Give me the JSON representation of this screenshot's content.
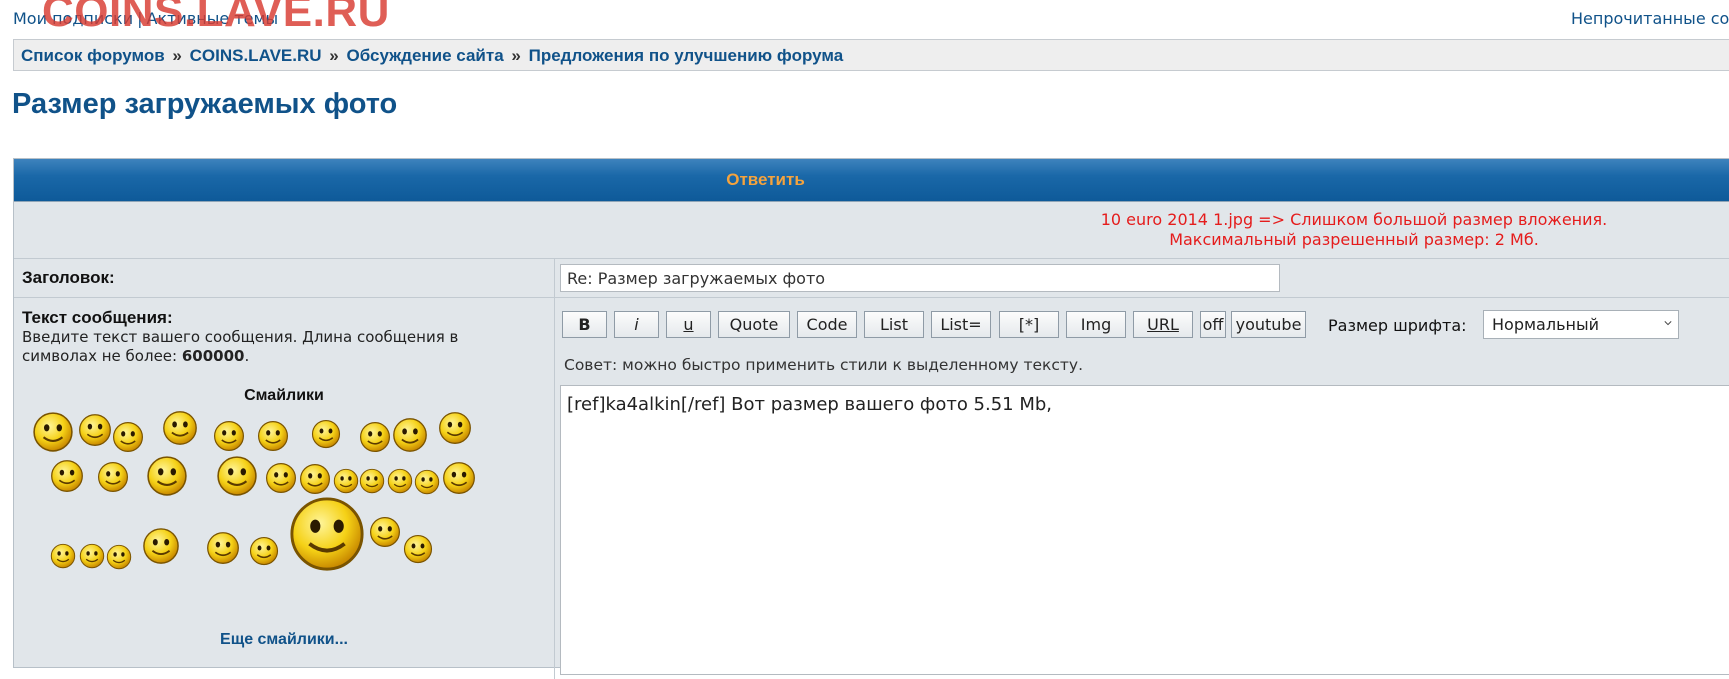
{
  "site": {
    "watermark": "COINS.LAVE.RU"
  },
  "top_links": {
    "my_subscriptions": "Мои подписки",
    "separator": "|",
    "active_topics": "Активные темы",
    "unread": "Непрочитанные со"
  },
  "breadcrumb": [
    {
      "label": "Список форумов"
    },
    {
      "label": "COINS.LAVE.RU"
    },
    {
      "label": "Обсуждение сайта"
    },
    {
      "label": "Предложения по улучшению форума"
    }
  ],
  "breadcrumb_separator": "»",
  "page_title": "Размер загружаемых фото",
  "form": {
    "header": "Ответить",
    "error_line1": "10 euro 2014 1.jpg => Слишком большой размер вложения.",
    "error_line2": "Максимальный разрешенный размер: 2 Мб.",
    "subject_label": "Заголовок:",
    "subject_value": "Re: Размер загружаемых фото",
    "message_label": "Текст сообщения:",
    "message_hint": "Введите текст вашего сообщения. Длина сообщения в символах не более:",
    "message_limit": "600000",
    "smilies_title": "Смайлики",
    "more_smilies": "Еще смайлики...",
    "bbcode_buttons": {
      "bold": "B",
      "italic": "i",
      "underline": "u",
      "quote": "Quote",
      "code": "Code",
      "list": "List",
      "list_ordered": "List=",
      "list_item": "[*]",
      "img": "Img",
      "url": "URL",
      "off": "off",
      "youtube": "youtube"
    },
    "font_size_label": "Размер шрифта:",
    "font_size_value": "Нормальный",
    "tip": "Совет: можно быстро применить стили к выделенному тексту.",
    "message_text": "[ref]ka4alkin[/ref] Вот размер вашего фото 5.51 Mb,"
  },
  "colors": {
    "link": "#105289",
    "header_text": "#f5a33d",
    "error": "#e51c1c",
    "watermark": "#d83b31"
  },
  "icons": [
    "smiley-icon",
    "chevron-down-icon"
  ]
}
